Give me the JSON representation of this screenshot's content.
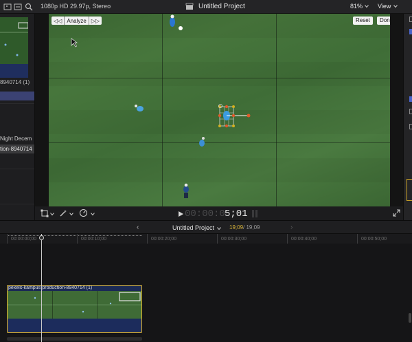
{
  "topbar": {
    "format": "1080p HD 29.97p, Stereo",
    "project_title": "Untitled Project",
    "zoom": "81%",
    "view": "View"
  },
  "browser": {
    "thumb_name": "8940714 (1)",
    "columns": "Night  Decem",
    "selected_clip": "tion-8940714"
  },
  "viewer": {
    "analyze": "Analyze",
    "reset": "Reset",
    "done": "Done",
    "timecode_dim": "00:00:0",
    "timecode_bright": "5;01"
  },
  "timeline": {
    "project_name": "Untitled Project",
    "current_tc": "19;09",
    "total_tc": "/ 19;09",
    "ruler_labels": [
      "00:00:00;00",
      "00:00:10;00",
      "00:00:20;00",
      "00:00:30;00",
      "00:00:40;00",
      "00:00:50;00"
    ],
    "clip_name": "pexels-kampus-production-8940714 (1)"
  },
  "colors": {
    "accent_yellow": "#e3b72d",
    "selection_blue": "#3b4273",
    "field_green": "#47763c"
  },
  "icons": [
    "film-browser-icon",
    "search-icon",
    "clapper-icon",
    "transform-icon",
    "magic-wand-icon",
    "speed-icon",
    "play-icon",
    "fullscreen-icon",
    "audio-meter-icon"
  ]
}
